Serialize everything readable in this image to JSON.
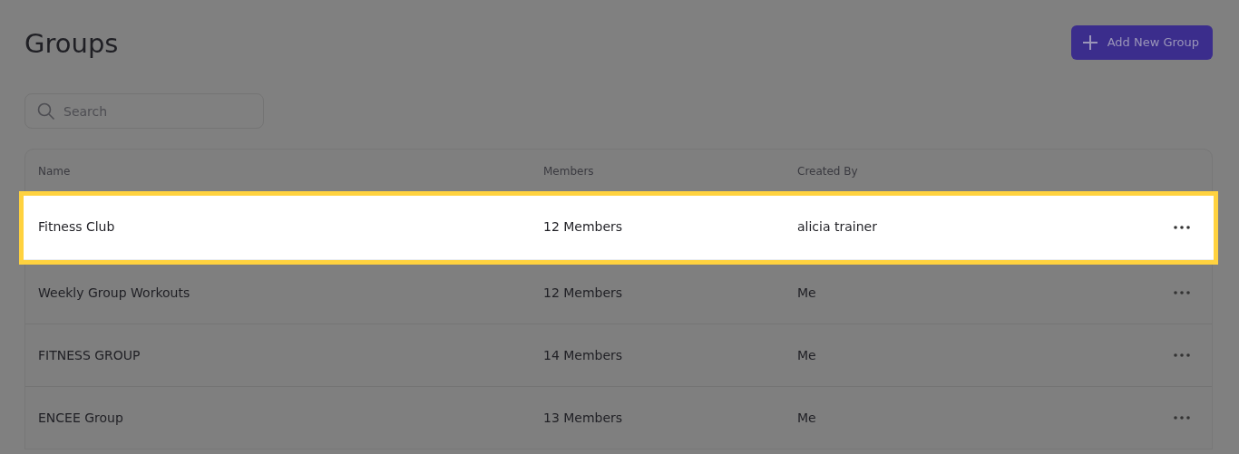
{
  "title": "Groups",
  "add_button": {
    "label": "Add New Group"
  },
  "search": {
    "placeholder": "Search"
  },
  "table": {
    "columns": [
      "Name",
      "Members",
      "Created By"
    ],
    "rows": [
      {
        "name": "Fitness Club",
        "members": "12 Members",
        "created_by": "alicia trainer",
        "highlighted": true
      },
      {
        "name": "Weekly Group Workouts",
        "members": "12 Members",
        "created_by": "Me",
        "highlighted": false
      },
      {
        "name": "FITNESS GROUP",
        "members": "14 Members",
        "created_by": "Me",
        "highlighted": false
      },
      {
        "name": "ENCEE Group",
        "members": "13 Members",
        "created_by": "Me",
        "highlighted": false
      }
    ]
  }
}
